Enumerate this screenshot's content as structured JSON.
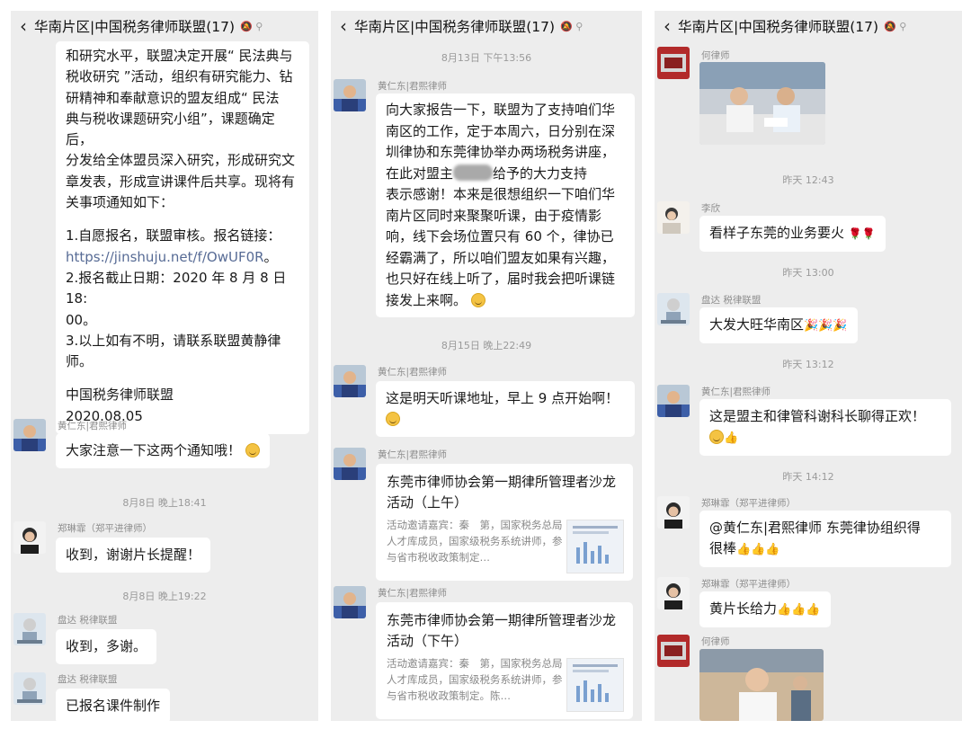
{
  "panels": [
    {
      "title": "华南片区|中国税务律师联盟(17)",
      "header_icons": "🔕 ⚲",
      "notice": {
        "lines": [
          "和研究水平，联盟决定开展“ 民法典与",
          "税收研究 ”活动，组织有研究能力、钻",
          "研精神和奉献意识的盟友组成“ 民法",
          "典与税收课题研究小组”，课题确定后，",
          "分发给全体盟员深入研究，形成研究文",
          "章发表，形成宣讲课件后共享。现将有",
          "关事项通知如下："
        ],
        "item1": "1.自愿报名，联盟审核。报名链接：",
        "link": "https://jinshuju.net/f/OwUF0R",
        "link_suffix": "。",
        "item2a": "2.报名截止日期：2020 年 8 月 8 日 18:",
        "item2b": "00。",
        "item3a": "3.以上如有不明，请联系联盟黄静律",
        "item3b": "师。",
        "org": "中国税务律师联盟",
        "date": "2020.08.05"
      },
      "msg1": {
        "sender": "黄仁东|君熙律师",
        "text": "大家注意一下这两个通知哦！"
      },
      "time1": "8月8日 晚上18:41",
      "msg2": {
        "sender": "郑琳霏（郑平进律师）",
        "text": "收到，谢谢片长提醒！"
      },
      "time2": "8月8日 晚上19:22",
      "msg3": {
        "sender": "盘达 税律联盟",
        "text": "收到，多谢。"
      },
      "msg4": {
        "sender": "盘达 税律联盟",
        "text": "已报名课件制作"
      }
    },
    {
      "title": "华南片区|中国税务律师联盟(17)",
      "header_icons": "🔕 ⚲",
      "time1": "8月13日 下午13:56",
      "msg1": {
        "sender": "黄仁东|君熙律师",
        "lines": [
          "向大家报告一下，联盟为了支持咱们华",
          "南区的工作，定于本周六，日分别在深",
          "圳律协和东莞律协举办两场税务讲座，"
        ],
        "line4a": "在此对盟主",
        "line4b": "给予的大力支持",
        "lines2": [
          "表示感谢！本来是很想组织一下咱们华",
          "南片区同时来聚聚听课，由于疫情影",
          "响，线下会场位置只有 60 个，律协已",
          "经霸满了，所以咱们盟友如果有兴趣，",
          "也只好在线上听了，届时我会把听课链"
        ],
        "last": "接发上来啊。"
      },
      "time2": "8月15日 晚上22:49",
      "msg2": {
        "sender": "黄仁东|君熙律师",
        "text": "这是明天听课地址，早上 9 点开始啊！"
      },
      "card1": {
        "sender": "黄仁东|君熙律师",
        "title": "东莞市律师协会第一期律所管理者沙龙活动（上午）",
        "desc": "活动邀请嘉宾：秦　第，国家税务总局人才库成员，国家级税务系统讲师，参与省市税收政策制定…"
      },
      "card2": {
        "sender": "黄仁东|君熙律师",
        "title": "东莞市律师协会第一期律所管理者沙龙活动（下午）",
        "desc": "活动邀请嘉宾：秦　第，国家税务总局人才库成员，国家级税务系统讲师，参与省市税收政策制定。陈…"
      }
    },
    {
      "title": "华南片区|中国税务律师联盟(17)",
      "header_icons": "🔕 ⚲",
      "msg1": {
        "sender": "何律师"
      },
      "time1": "昨天 12:43",
      "msg2": {
        "sender": "李欣",
        "text": "看样子东莞的业务要火"
      },
      "time2": "昨天 13:00",
      "msg3": {
        "sender": "盘达 税律联盟",
        "text": "大发大旺华南区"
      },
      "time3": "昨天 13:12",
      "msg4": {
        "sender": "黄仁东|君熙律师",
        "text": "这是盟主和律管科谢科长聊得正欢！"
      },
      "time4": "昨天 14:12",
      "msg5": {
        "sender": "郑琳霏（郑平进律师）",
        "text_a": "@黄仁东|君熙律师  东莞律协组织得",
        "text_b": "很棒"
      },
      "msg6": {
        "sender": "郑琳霏（郑平进律师）",
        "text": "黄片长给力"
      },
      "msg7": {
        "sender": "何律师"
      }
    }
  ],
  "emoji": {
    "smile": "smile-emoji",
    "rose": "🌹",
    "thumbs": "👍",
    "party": "🎉"
  }
}
